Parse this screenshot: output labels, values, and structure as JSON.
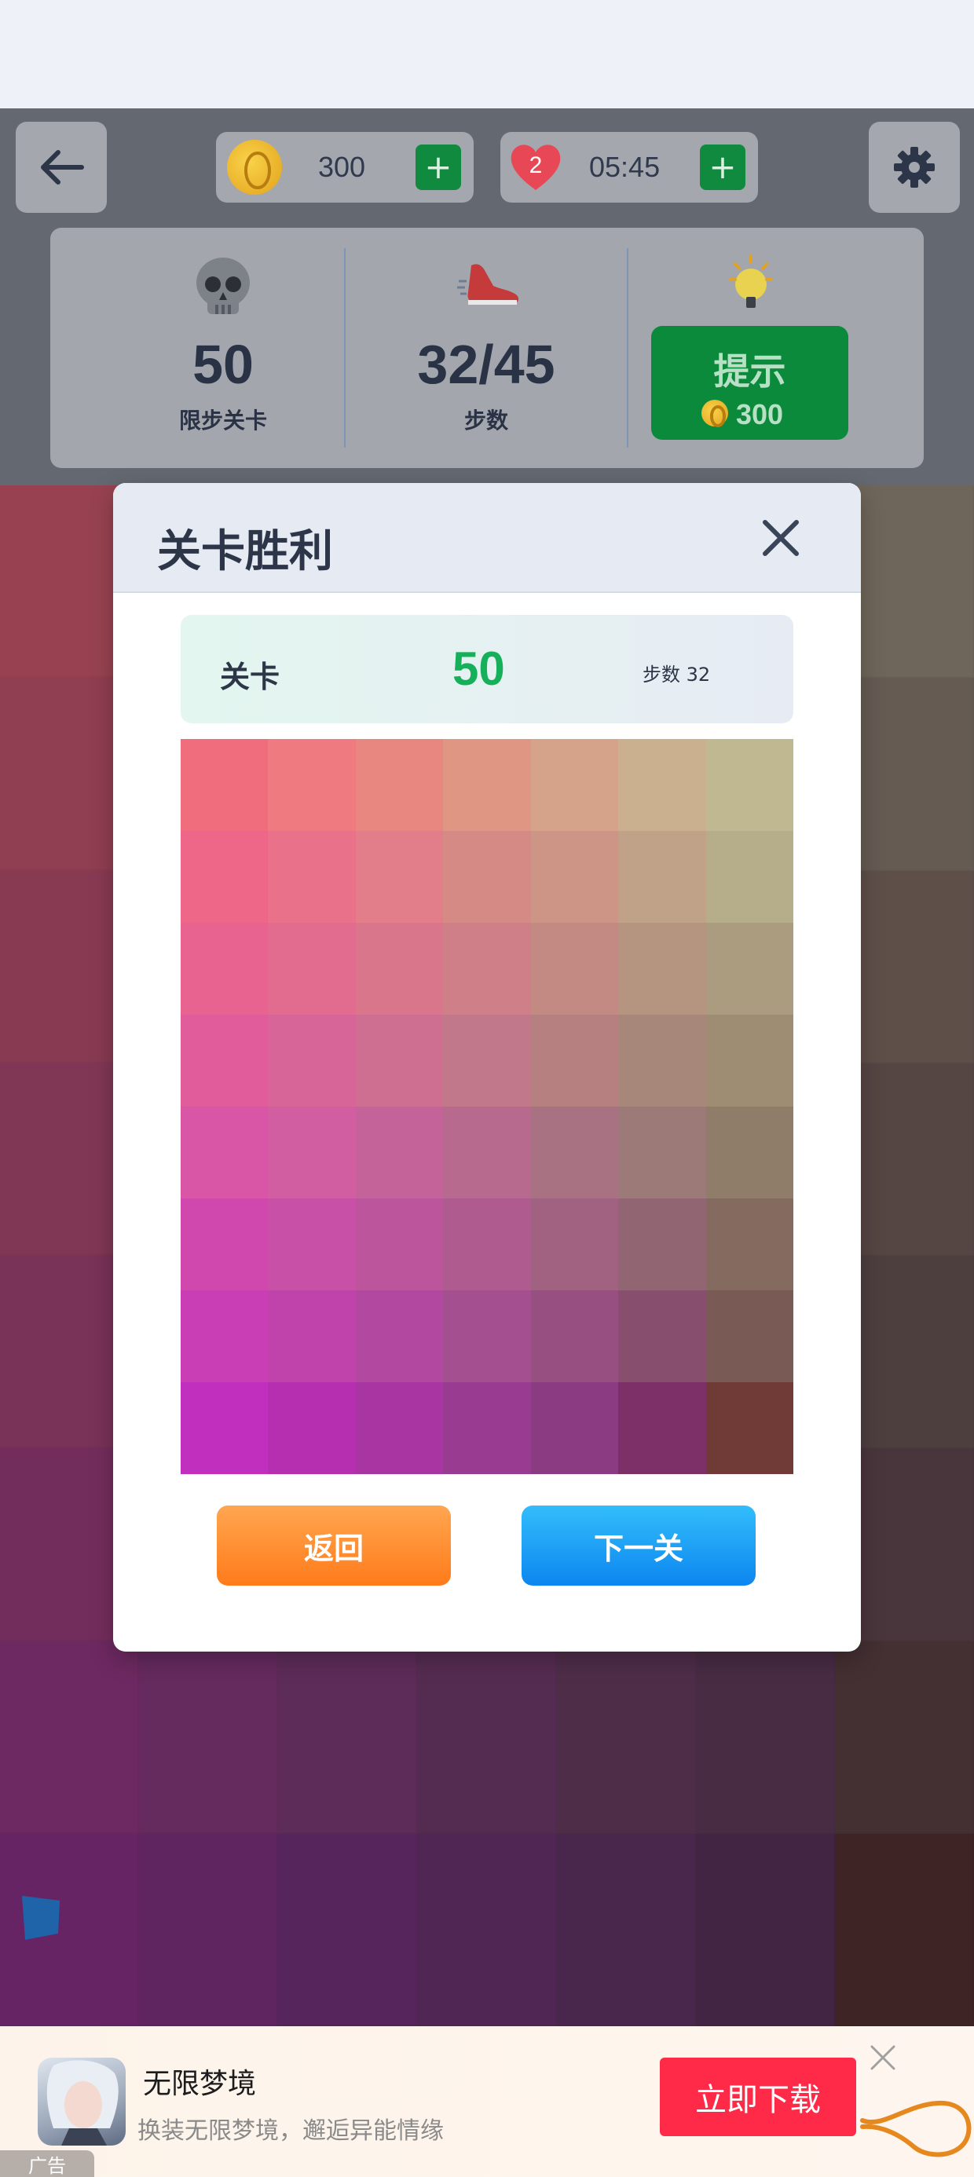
{
  "header": {
    "coins": "300",
    "lives": "2",
    "timer": "05:45"
  },
  "stats": {
    "level_value": "50",
    "level_label": "限步关卡",
    "steps_value": "32/45",
    "steps_label": "步数",
    "hint_label": "提示",
    "hint_cost": "300"
  },
  "modal": {
    "title": "关卡胜利",
    "level_label": "关卡",
    "level_number": "50",
    "steps_text": "步数 32",
    "back_label": "返回",
    "next_label": "下一关"
  },
  "result_grid": {
    "columns": 7,
    "rows": 8,
    "colors": [
      [
        "#f06d7e",
        "#ef7a7f",
        "#e88680",
        "#df9683",
        "#d4a389",
        "#cab08f",
        "#bfb890"
      ],
      [
        "#ee6788",
        "#e9718a",
        "#e17e89",
        "#d58a86",
        "#cc9585",
        "#bfa287",
        "#b6ad8a"
      ],
      [
        "#e96390",
        "#e26c8f",
        "#d9768c",
        "#ce7f87",
        "#c38a83",
        "#b69580",
        "#ab9c80"
      ],
      [
        "#e15c9a",
        "#d86597",
        "#ce6f92",
        "#c2788b",
        "#b67f80",
        "#a8877b",
        "#9e8c73"
      ],
      [
        "#d955a5",
        "#d05ea1",
        "#c4629a",
        "#b76a8e",
        "#a97282",
        "#9b7a78",
        "#8f7d6a"
      ],
      [
        "#d048ad",
        "#c850a6",
        "#bd559d",
        "#af5b8f",
        "#a06280",
        "#926573",
        "#856a5f"
      ],
      [
        "#c93eb5",
        "#bf43ab",
        "#b248a0",
        "#a44f90",
        "#964f80",
        "#874e6e",
        "#7a5a55"
      ],
      [
        "#c12fbf",
        "#b62fb0",
        "#a935a3",
        "#9a3b92",
        "#8b3b82",
        "#7d2f68",
        "#703a37"
      ]
    ]
  },
  "background_grid": {
    "colors": [
      [
        "#c44d5e",
        "#b9505f",
        "#ad5a60",
        "#a36462",
        "#9a6d66",
        "#917567",
        "#897f6a"
      ],
      [
        "#b9475f",
        "#ae4b60",
        "#a35260",
        "#985a5e",
        "#8e605e",
        "#856960",
        "#7d7060"
      ],
      [
        "#ae4260",
        "#a4455f",
        "#994b5e",
        "#8e5259",
        "#845857",
        "#7b5e56",
        "#735f52"
      ],
      [
        "#a33d63",
        "#983f61",
        "#8c445d",
        "#814a57",
        "#784e52",
        "#6e5350",
        "#67534b"
      ],
      [
        "#993767",
        "#8e3a63",
        "#823e5e",
        "#774156",
        "#6d4550",
        "#64484c",
        "#5d4944"
      ],
      [
        "#90306d",
        "#85336a",
        "#7a3663",
        "#6f385a",
        "#663a52",
        "#5d3c4c",
        "#563c40"
      ],
      [
        "#882a74",
        "#7d2c6f",
        "#722e67",
        "#672f5d",
        "#5e3053",
        "#552f4b",
        "#503232"
      ],
      [
        "#7f2379",
        "#742473",
        "#69256b",
        "#5f2661",
        "#562655",
        "#4d244a",
        "#492321"
      ]
    ]
  },
  "ad": {
    "title": "无限梦境",
    "description": "换装无限梦境，邂逅异能情缘",
    "cta": "立即下载",
    "tag": "广告"
  }
}
